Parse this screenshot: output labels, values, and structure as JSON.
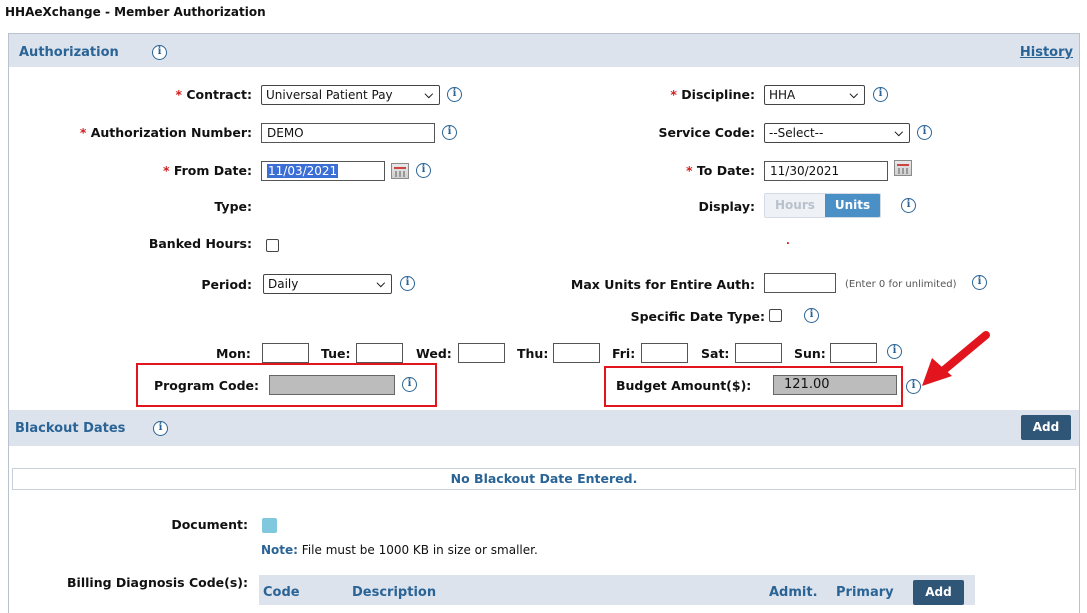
{
  "window": {
    "title": "HHAeXchange - Member Authorization"
  },
  "authorization": {
    "section_title": "Authorization",
    "history_link": "History",
    "required_mark": "*",
    "contract": {
      "label": "Contract:",
      "value": "Universal Patient Pay"
    },
    "discipline": {
      "label": "Discipline:",
      "value": "HHA"
    },
    "auth_number": {
      "label": "Authorization Number:",
      "value": "DEMO"
    },
    "service_code": {
      "label": "Service Code:",
      "value": "--Select--"
    },
    "from_date": {
      "label": "From Date:",
      "value": "11/03/2021"
    },
    "to_date": {
      "label": "To Date:",
      "value": "11/30/2021"
    },
    "type": {
      "label": "Type:"
    },
    "display": {
      "label": "Display:",
      "options": [
        "Hours",
        "Units"
      ],
      "selected": "Units"
    },
    "banked_hours": {
      "label": "Banked Hours:",
      "checked": false
    },
    "period": {
      "label": "Period:",
      "value": "Daily"
    },
    "max_units": {
      "label": "Max Units for Entire Auth:",
      "value": "",
      "hint": "(Enter 0 for unlimited)"
    },
    "specific_date_type": {
      "label": "Specific Date Type:",
      "checked": false
    },
    "days": [
      {
        "label": "Mon:",
        "value": ""
      },
      {
        "label": "Tue:",
        "value": ""
      },
      {
        "label": "Wed:",
        "value": ""
      },
      {
        "label": "Thu:",
        "value": ""
      },
      {
        "label": "Fri:",
        "value": ""
      },
      {
        "label": "Sat:",
        "value": ""
      },
      {
        "label": "Sun:",
        "value": ""
      }
    ],
    "program_code": {
      "label": "Program Code:",
      "value": ""
    },
    "budget_amount": {
      "label": "Budget Amount($):",
      "value": "121.00"
    }
  },
  "blackout": {
    "section_title": "Blackout Dates",
    "add_button": "Add",
    "empty_message": "No Blackout Date Entered."
  },
  "document": {
    "label": "Document:",
    "note_bold": "Note:",
    "note_text": "File must be 1000 KB in size or smaller."
  },
  "billing_diagnosis": {
    "label": "Billing Diagnosis Code(s):",
    "columns": [
      "Code",
      "Description",
      "Admit.",
      "Primary"
    ],
    "add_button": "Add"
  },
  "colors": {
    "accent": "#2a6496",
    "section_bg": "#dde3ec",
    "required": "#d21e1e",
    "highlight": "#e2151e",
    "button": "#2f5577"
  }
}
